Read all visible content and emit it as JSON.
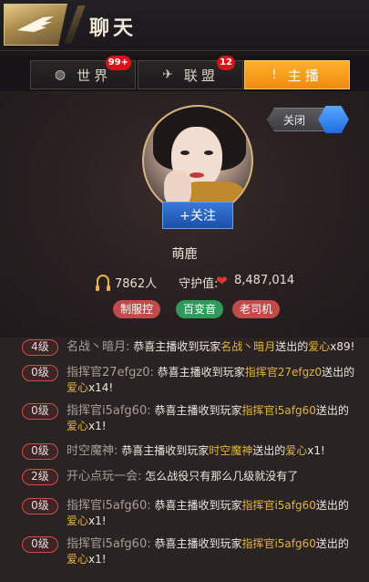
{
  "header": {
    "title": "聊天",
    "logo_icon": "eagle-logo-icon"
  },
  "tabs": [
    {
      "label": "世界",
      "icon": "globe-icon",
      "badge": "99+",
      "active": false
    },
    {
      "label": "联盟",
      "icon": "wings-icon",
      "badge": "12",
      "active": false
    },
    {
      "label": "主播",
      "icon": "exclamation-icon",
      "badge": "",
      "active": true
    }
  ],
  "toggle": {
    "label": "关闭"
  },
  "anchor": {
    "follow_label": "+关注",
    "name": "萌鹿",
    "fans_count": "7862人",
    "guard_label": "守护值:",
    "guard_value": "8,487,014",
    "tags": [
      {
        "label": "制服控",
        "color": "#c34a4a"
      },
      {
        "label": "百变音",
        "color": "#2f9a5a"
      },
      {
        "label": "老司机",
        "color": "#c34a4a"
      }
    ]
  },
  "messages": [
    {
      "level": "4级",
      "sender": "名战丶暗月:",
      "parts": [
        {
          "t": "恭喜主播收到玩家"
        },
        {
          "t": "名战丶暗月",
          "h": true
        },
        {
          "t": "送出的"
        },
        {
          "t": "爱心",
          "h": true
        },
        {
          "t": "x89!"
        }
      ]
    },
    {
      "level": "0级",
      "sender": "指挥官27efgz0:",
      "parts": [
        {
          "t": "恭喜主播收到玩家"
        },
        {
          "t": "指挥官27efgz0",
          "h": true
        },
        {
          "t": "送出的"
        },
        {
          "t": "爱心",
          "h": true
        },
        {
          "t": "x14!"
        }
      ]
    },
    {
      "level": "0级",
      "sender": "指挥官i5afg60:",
      "parts": [
        {
          "t": "恭喜主播收到玩家"
        },
        {
          "t": "指挥官i5afg60",
          "h": true
        },
        {
          "t": "送出的"
        },
        {
          "t": "爱心",
          "h": true
        },
        {
          "t": "x1!"
        }
      ]
    },
    {
      "level": "0级",
      "sender": "时空魔神:",
      "parts": [
        {
          "t": "恭喜主播收到玩家"
        },
        {
          "t": "时空魔神",
          "h": true
        },
        {
          "t": "送出的"
        },
        {
          "t": "爱心",
          "h": true
        },
        {
          "t": "x1!"
        }
      ]
    },
    {
      "level": "2级",
      "sender": "开心点玩一会:",
      "parts": [
        {
          "t": "怎么战役只有那么几级就没有了"
        }
      ]
    },
    {
      "level": "0级",
      "sender": "指挥官i5afg60:",
      "parts": [
        {
          "t": "恭喜主播收到玩家"
        },
        {
          "t": "指挥官i5afg60",
          "h": true
        },
        {
          "t": "送出的"
        },
        {
          "t": "爱心",
          "h": true
        },
        {
          "t": "x1!"
        }
      ]
    },
    {
      "level": "0级",
      "sender": "指挥官i5afg60:",
      "parts": [
        {
          "t": "恭喜主播收到玩家"
        },
        {
          "t": "指挥官i5afg60",
          "h": true
        },
        {
          "t": "送出的"
        },
        {
          "t": "爱心",
          "h": true
        },
        {
          "t": "x1!"
        }
      ]
    }
  ]
}
